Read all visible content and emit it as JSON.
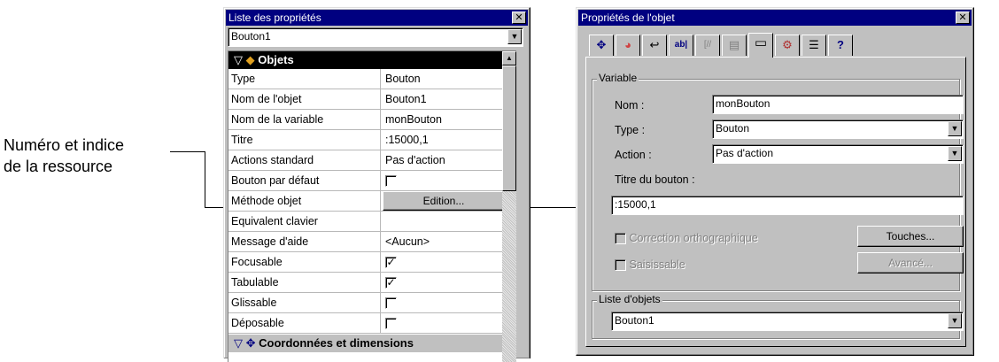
{
  "callout": {
    "line1": "Numéro et indice",
    "line2": "de la ressource"
  },
  "property_list": {
    "title": "Liste des propriétés",
    "close_glyph": "✕",
    "object_selector": "Bouton1",
    "group_objects": "Objets",
    "group_coords": "Coordonnées et dimensions",
    "rows": [
      {
        "name": "Type",
        "value": "Bouton"
      },
      {
        "name": "Nom de l'objet",
        "value": "Bouton1"
      },
      {
        "name": "Nom de la variable",
        "value": "monBouton"
      },
      {
        "name": "Titre",
        "value": ":15000,1"
      },
      {
        "name": "Actions standard",
        "value": "Pas d'action"
      },
      {
        "name": "Bouton par défaut",
        "value": ""
      },
      {
        "name": "Méthode objet",
        "value": "Edition..."
      },
      {
        "name": "Equivalent clavier",
        "value": ""
      },
      {
        "name": "Message d'aide",
        "value": "<Aucun>"
      },
      {
        "name": "Focusable",
        "value": ""
      },
      {
        "name": "Tabulable",
        "value": ""
      },
      {
        "name": "Glissable",
        "value": ""
      },
      {
        "name": "Déposable",
        "value": ""
      }
    ],
    "checks": {
      "bouton_par_defaut": false,
      "focusable": true,
      "tabulable": true,
      "glissable": false,
      "deposable": false
    }
  },
  "object_props": {
    "title": "Propriétés de l'objet",
    "close_glyph": "✕",
    "tabs": [
      {
        "icon": "move-icon",
        "glyph": "✥"
      },
      {
        "icon": "color-wheel-icon",
        "glyph": "◕"
      },
      {
        "icon": "action-icon",
        "glyph": "↩"
      },
      {
        "icon": "entry-field-icon",
        "glyph": "ab|"
      },
      {
        "icon": "format-icon",
        "glyph": "[//"
      },
      {
        "icon": "list-icon",
        "glyph": "▤"
      },
      {
        "icon": "button-icon",
        "glyph": "▭"
      },
      {
        "icon": "help-tip-icon",
        "glyph": "⚙"
      },
      {
        "icon": "text-style-icon",
        "glyph": "☰"
      },
      {
        "icon": "help-icon",
        "glyph": "?"
      }
    ],
    "variable_group": "Variable",
    "nom_label": "Nom :",
    "nom_value": "monBouton",
    "type_label": "Type :",
    "type_value": "Bouton",
    "action_label": "Action :",
    "action_value": "Pas d'action",
    "titre_label": "Titre du bouton :",
    "titre_value": ":15000,1",
    "correction_label": "Correction orthographique",
    "saisissable_label": "Saisissable",
    "touches_button": "Touches...",
    "avance_button": "Avancé...",
    "liste_group": "Liste d'objets",
    "liste_value": "Bouton1"
  }
}
